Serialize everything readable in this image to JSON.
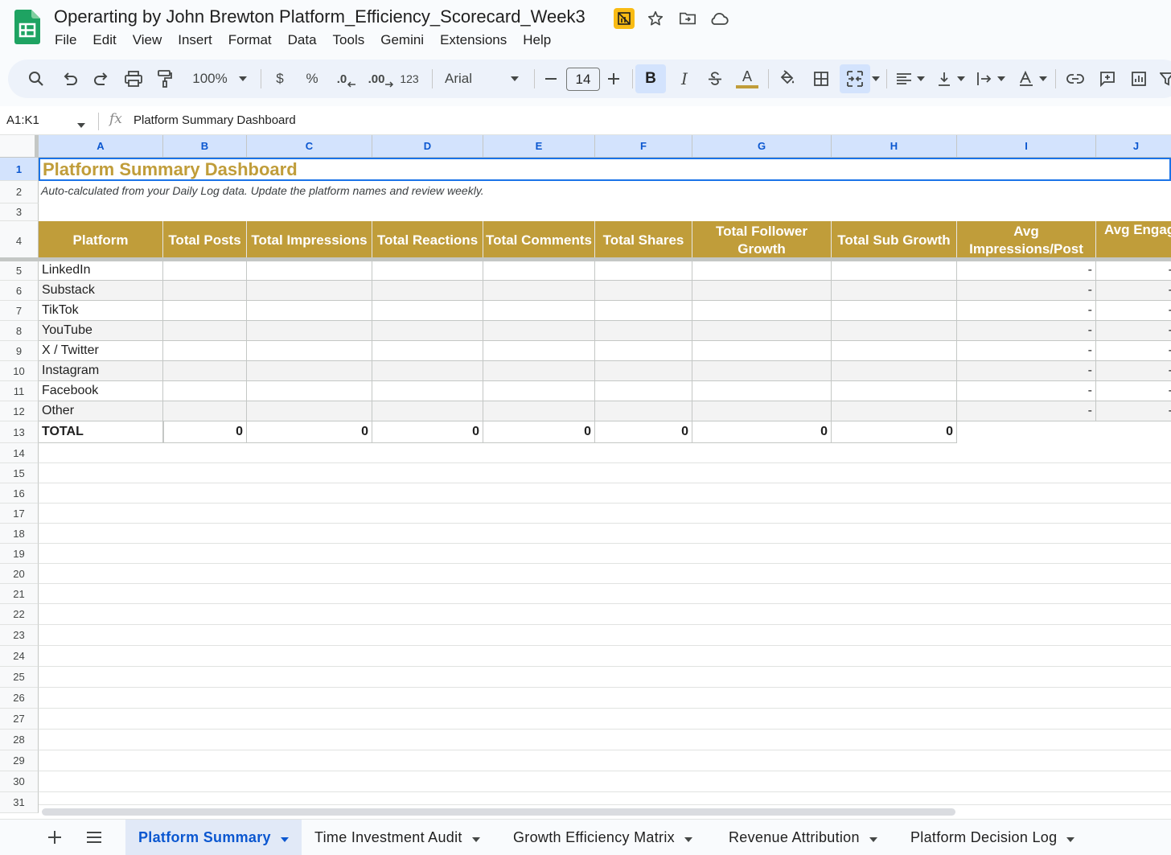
{
  "app": {
    "title": "Operarting by John Brewton Platform_Efficiency_Scorecard_Week3",
    "menus": [
      "File",
      "Edit",
      "View",
      "Insert",
      "Format",
      "Data",
      "Tools",
      "Gemini",
      "Extensions",
      "Help"
    ]
  },
  "toolbar": {
    "zoom": "100%",
    "currency": "$",
    "percent": "%",
    "decrease_decimal": ".0",
    "increase_decimal": ".00",
    "number_format": "123",
    "font": "Arial",
    "font_size": "14",
    "bold": "B",
    "italic": "I",
    "text_color": "A",
    "accent_color": "#c09d3a"
  },
  "formula_bar": {
    "name_box": "A1:K1",
    "fx": "fx",
    "formula": "Platform Summary Dashboard"
  },
  "grid": {
    "columns": [
      "A",
      "B",
      "C",
      "D",
      "E",
      "F",
      "G",
      "H",
      "I",
      "J"
    ],
    "rows": [
      "1",
      "2",
      "3",
      "4",
      "5",
      "6",
      "7",
      "8",
      "9",
      "10",
      "11",
      "12",
      "13",
      "14",
      "15",
      "16",
      "17",
      "18",
      "19",
      "20",
      "21",
      "22",
      "23",
      "24",
      "25",
      "26",
      "27",
      "28",
      "29",
      "30",
      "31"
    ],
    "title": "Platform Summary Dashboard",
    "subtitle": "Auto-calculated from your Daily Log data. Update the platform names and review weekly.",
    "headers": [
      "Platform",
      "Total Posts",
      "Total Impressions",
      "Total Reactions",
      "Total Comments",
      "Total Shares",
      "Total Follower Growth",
      "Total Sub Growth",
      "Avg Impressions/Post",
      "Avg Engagement"
    ],
    "platforms": [
      {
        "name": "LinkedIn",
        "avg_impressions": "-",
        "avg_engagement": "-"
      },
      {
        "name": "Substack",
        "avg_impressions": "-",
        "avg_engagement": "-"
      },
      {
        "name": "TikTok",
        "avg_impressions": "-",
        "avg_engagement": "-"
      },
      {
        "name": "YouTube",
        "avg_impressions": "-",
        "avg_engagement": "-"
      },
      {
        "name": "X / Twitter",
        "avg_impressions": "-",
        "avg_engagement": "-"
      },
      {
        "name": "Instagram",
        "avg_impressions": "-",
        "avg_engagement": "-"
      },
      {
        "name": "Facebook",
        "avg_impressions": "-",
        "avg_engagement": "-"
      },
      {
        "name": "Other",
        "avg_impressions": "-",
        "avg_engagement": "-"
      }
    ],
    "total_label": "TOTAL",
    "totals": [
      "0",
      "0",
      "0",
      "0",
      "0",
      "0",
      "0"
    ],
    "header_color": "#c09d3a",
    "selection_color": "#1a73e8"
  },
  "sheets": {
    "tabs": [
      {
        "label": "Platform Summary",
        "active": true
      },
      {
        "label": "Time Investment Audit",
        "active": false
      },
      {
        "label": "Growth Efficiency Matrix",
        "active": false
      },
      {
        "label": "Revenue Attribution",
        "active": false
      },
      {
        "label": "Platform Decision Log",
        "active": false
      }
    ]
  }
}
